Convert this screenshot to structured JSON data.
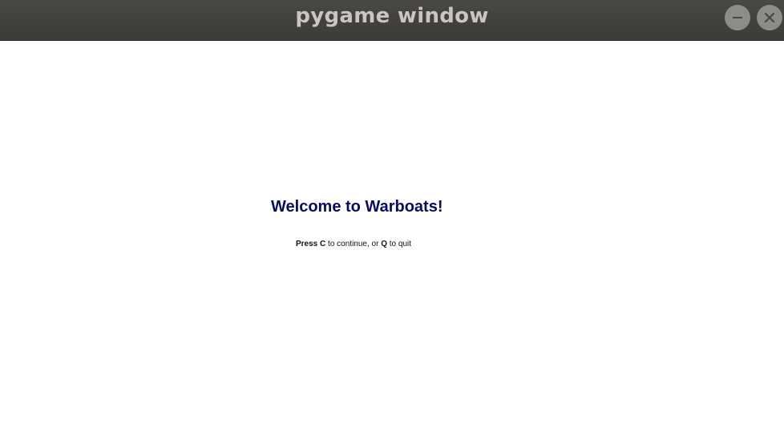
{
  "window": {
    "title": "pygame window",
    "controls": {
      "minimize_icon": "minimize-icon",
      "close_icon": "close-icon"
    }
  },
  "game": {
    "welcome_text": "Welcome to Warboats!",
    "instructions": {
      "press": "Press",
      "continue_key": "C",
      "continue_text": "to continue, or",
      "quit_key": "Q",
      "quit_text": "to quit"
    },
    "colors": {
      "welcome_text": "#0b0b5e",
      "background": "#ffffff"
    }
  }
}
